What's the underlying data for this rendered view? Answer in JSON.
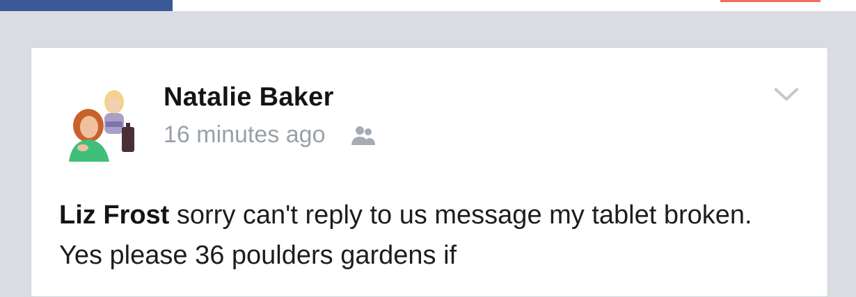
{
  "post": {
    "author": "Natalie Baker",
    "timestamp": "16 minutes ago",
    "mention": "Liz Frost",
    "body": " sorry can't reply to us message my tablet broken. Yes please 36 poulders gardens if"
  },
  "icons": {
    "audience": "friends-audience-icon",
    "options": "chevron-down-icon"
  },
  "colors": {
    "brand_blue": "#3b5998",
    "accent_red": "#f26c5f",
    "muted_text": "#9aa0a8"
  }
}
